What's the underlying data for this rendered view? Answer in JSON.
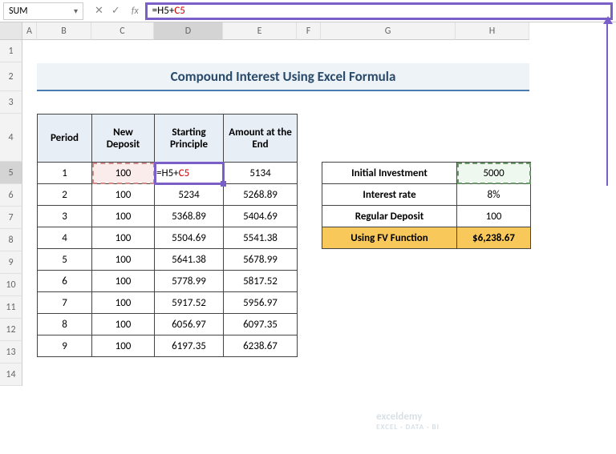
{
  "nameBox": "SUM",
  "formula": {
    "prefix": "=H5+",
    "ref": "C5"
  },
  "title": "Compound Interest Using Excel Formula",
  "columns": [
    "A",
    "B",
    "C",
    "D",
    "E",
    "F",
    "G",
    "H"
  ],
  "rows": [
    "1",
    "2",
    "3",
    "4",
    "5",
    "6",
    "7",
    "8",
    "9",
    "10",
    "11",
    "12",
    "13",
    "14"
  ],
  "headers": {
    "period": "Period",
    "deposit": "New Deposit",
    "start": "Starting Principle",
    "end": "Amount at the End"
  },
  "editingCell": {
    "prefix": "=H5+",
    "ref": "C5"
  },
  "tableRows": [
    {
      "p": "1",
      "dep": "100",
      "start": "",
      "end": "5134"
    },
    {
      "p": "2",
      "dep": "100",
      "start": "5234",
      "end": "5268.89"
    },
    {
      "p": "3",
      "dep": "100",
      "start": "5368.89",
      "end": "5404.69"
    },
    {
      "p": "4",
      "dep": "100",
      "start": "5504.69",
      "end": "5541.38"
    },
    {
      "p": "5",
      "dep": "100",
      "start": "5641.38",
      "end": "5678.99"
    },
    {
      "p": "6",
      "dep": "100",
      "start": "5778.99",
      "end": "5817.52"
    },
    {
      "p": "7",
      "dep": "100",
      "start": "5917.52",
      "end": "5956.97"
    },
    {
      "p": "8",
      "dep": "100",
      "start": "6056.97",
      "end": "6097.35"
    },
    {
      "p": "9",
      "dep": "100",
      "start": "6197.35",
      "end": "6238.67"
    }
  ],
  "side": [
    {
      "label": "Initial Investment",
      "value": "5000"
    },
    {
      "label": "Interest rate",
      "value": "8%"
    },
    {
      "label": "Regular Deposit",
      "value": "100"
    },
    {
      "label": "Using FV Function",
      "value": "$6,238.67"
    }
  ],
  "watermark": {
    "main": "exceldemy",
    "sub": "EXCEL · DATA · BI"
  }
}
